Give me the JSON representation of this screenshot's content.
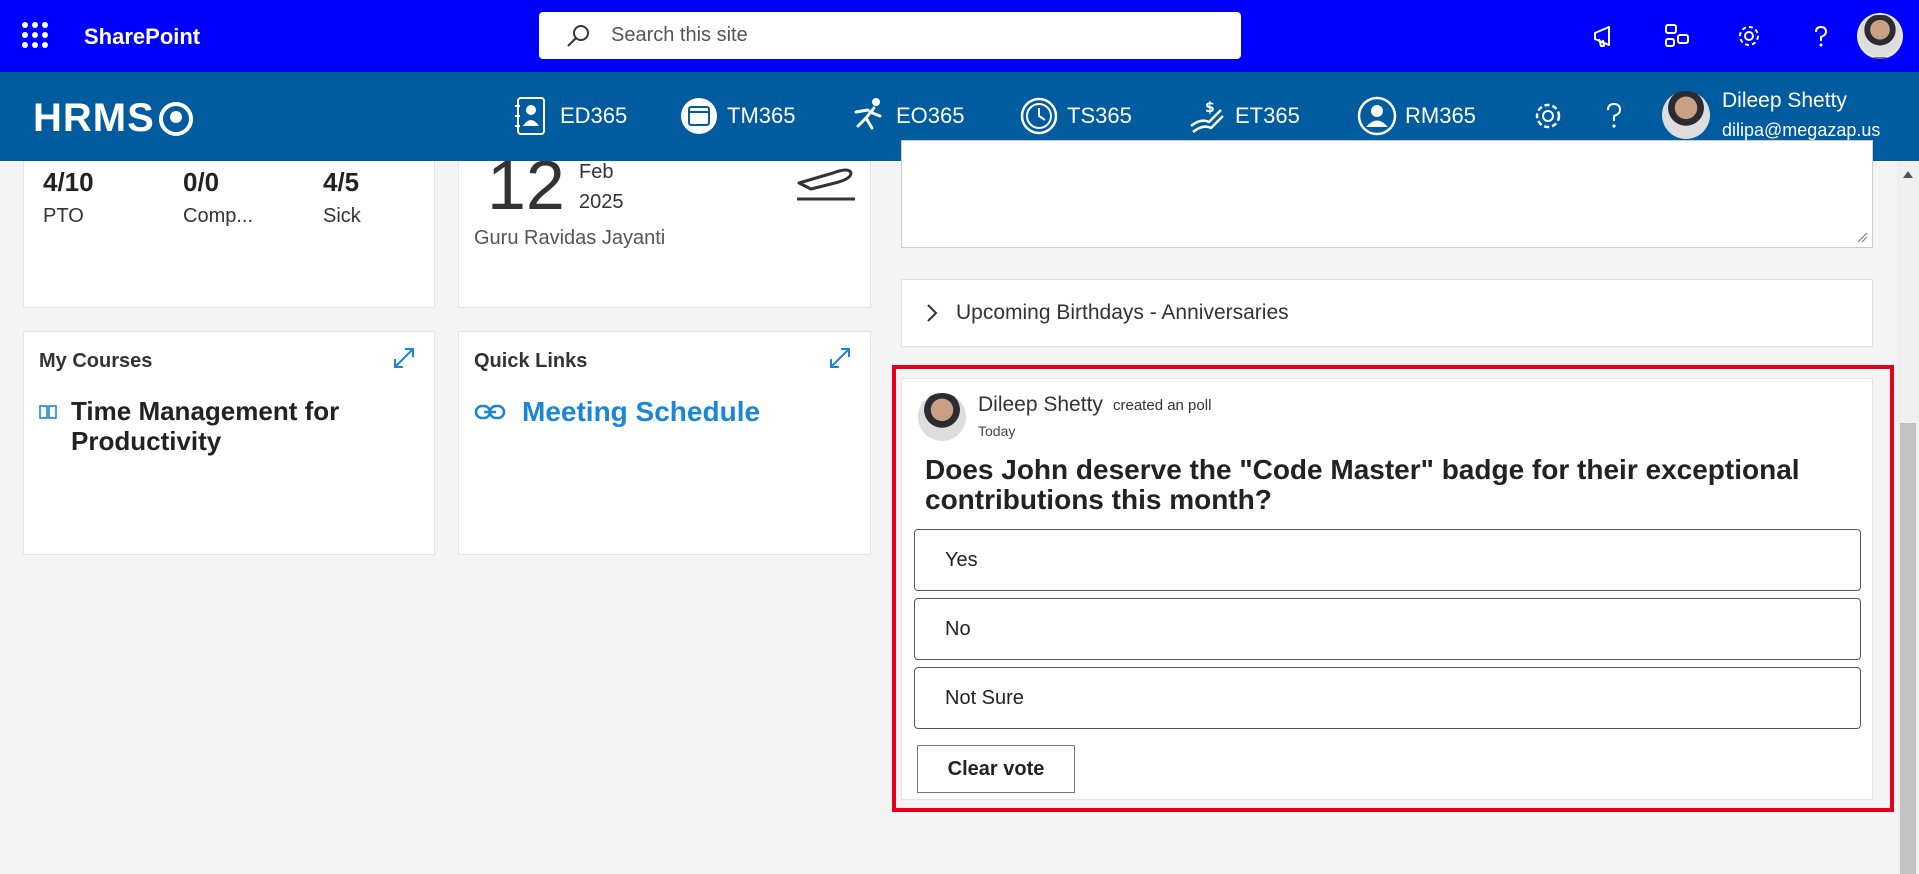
{
  "suitebar": {
    "app_name": "SharePoint",
    "search_placeholder": "Search this site",
    "icons": [
      "megaphone-icon",
      "share-icon",
      "gear-icon",
      "help-icon",
      "account-avatar"
    ],
    "bg_color": "#0000ff"
  },
  "hrms": {
    "logo": "HRMS",
    "nav": [
      {
        "label": "ED365",
        "icon": "directory-icon"
      },
      {
        "label": "TM365",
        "icon": "calendar-icon"
      },
      {
        "label": "EO365",
        "icon": "onboarding-icon"
      },
      {
        "label": "TS365",
        "icon": "clock-icon"
      },
      {
        "label": "ET365",
        "icon": "expense-icon"
      },
      {
        "label": "RM365",
        "icon": "person-icon"
      }
    ],
    "settings_icon": "gear-icon",
    "help_icon": "help-icon",
    "user": {
      "name": "Dileep Shetty",
      "email": "dilipa@megazap.us"
    },
    "bg_color": "#005b9f"
  },
  "leave_balance": {
    "items": [
      {
        "value": "4/10",
        "label": "PTO"
      },
      {
        "value": "0/0",
        "label": "Comp..."
      },
      {
        "value": "4/5",
        "label": "Sick"
      }
    ]
  },
  "holiday": {
    "day": "12",
    "month": "Feb",
    "year": "2025",
    "name": "Guru Ravidas Jayanti"
  },
  "my_courses": {
    "title": "My Courses",
    "course": "Time Management for Productivity"
  },
  "quick_links": {
    "title": "Quick Links",
    "link": "Meeting Schedule"
  },
  "accordion": {
    "label": "Upcoming Birthdays - Anniversaries"
  },
  "poll": {
    "author": "Dileep Shetty",
    "action": "created an poll",
    "time": "Today",
    "question": "Does John deserve the \"Code Master\" badge for their exceptional contributions this month?",
    "options": [
      "Yes",
      "No",
      "Not Sure"
    ],
    "clear_label": "Clear vote",
    "highlight_color": "#e6001a"
  }
}
